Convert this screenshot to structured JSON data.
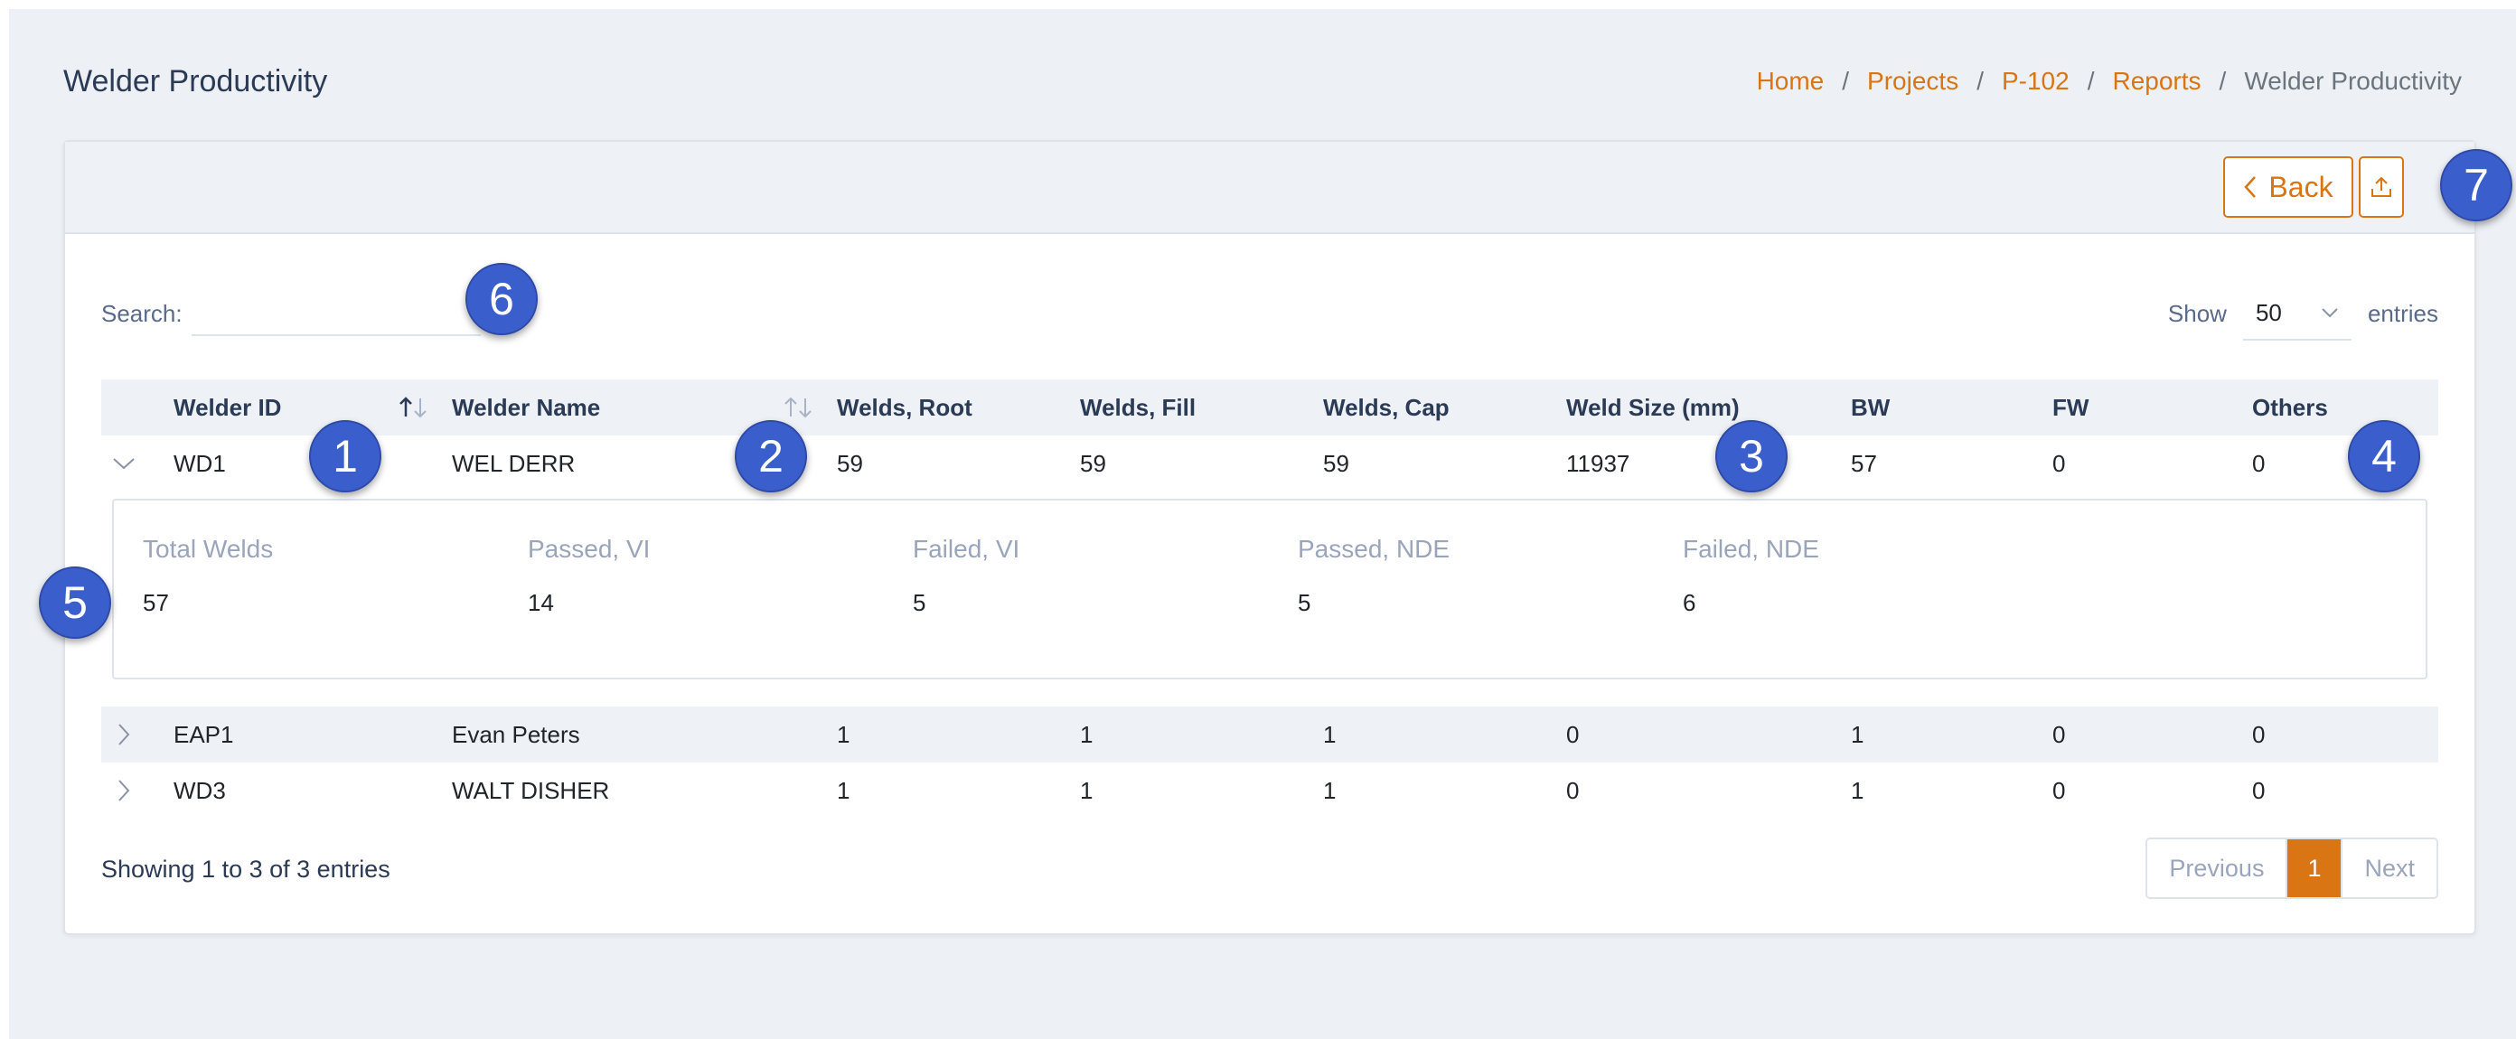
{
  "page": {
    "title": "Welder Productivity",
    "breadcrumb": [
      "Home",
      "Projects",
      "P-102",
      "Reports"
    ],
    "breadcrumb_current": "Welder Productivity",
    "breadcrumb_sep": "/"
  },
  "toolbar": {
    "back_label": "Back",
    "export_icon": "upload-icon"
  },
  "search": {
    "label": "Search:",
    "value": "",
    "placeholder": ""
  },
  "length": {
    "show_label": "Show",
    "value": "50",
    "entries_label": "entries"
  },
  "table": {
    "columns": [
      "Welder ID",
      "Welder Name",
      "Welds, Root",
      "Welds, Fill",
      "Welds, Cap",
      "Weld Size (mm)",
      "BW",
      "FW",
      "Others"
    ],
    "rows": [
      {
        "id": "WD1",
        "name": "WEL DERR",
        "root": "59",
        "fill": "59",
        "cap": "59",
        "size": "11937",
        "bw": "57",
        "fw": "0",
        "others": "0"
      },
      {
        "id": "EAP1",
        "name": "Evan Peters",
        "root": "1",
        "fill": "1",
        "cap": "1",
        "size": "0",
        "bw": "1",
        "fw": "0",
        "others": "0"
      },
      {
        "id": "WD3",
        "name": "WALT DISHER",
        "root": "1",
        "fill": "1",
        "cap": "1",
        "size": "0",
        "bw": "1",
        "fw": "0",
        "others": "0"
      }
    ],
    "detail": {
      "labels": [
        "Total Welds",
        "Passed, VI",
        "Failed, VI",
        "Passed, NDE",
        "Failed, NDE"
      ],
      "values": [
        "57",
        "14",
        "5",
        "5",
        "6"
      ]
    }
  },
  "footer": {
    "info": "Showing 1 to 3 of 3 entries",
    "previous": "Previous",
    "page": "1",
    "next": "Next"
  },
  "markers": [
    "1",
    "2",
    "3",
    "4",
    "5",
    "6",
    "7"
  ],
  "colors": {
    "accent": "#d97512",
    "marker": "#3a5fcd",
    "header_bg": "#eef1f6",
    "page_bg": "#edf0f5"
  }
}
